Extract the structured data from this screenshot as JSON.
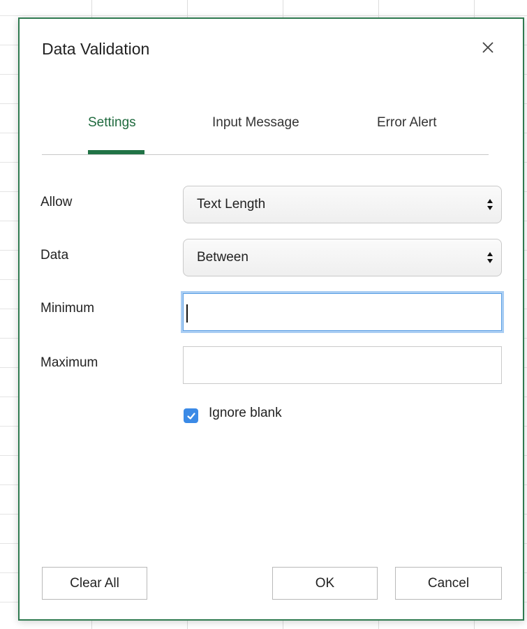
{
  "dialog": {
    "title": "Data Validation",
    "close_icon": "close-icon",
    "accent_color": "#217346"
  },
  "tabs": [
    {
      "label": "Settings",
      "active": true
    },
    {
      "label": "Input Message",
      "active": false
    },
    {
      "label": "Error Alert",
      "active": false
    }
  ],
  "form": {
    "allow": {
      "label": "Allow",
      "value": "Text Length"
    },
    "data": {
      "label": "Data",
      "value": "Between"
    },
    "minimum": {
      "label": "Minimum",
      "value": "",
      "focused": true
    },
    "maximum": {
      "label": "Maximum",
      "value": ""
    },
    "ignore_blank": {
      "label": "Ignore blank",
      "checked": true
    }
  },
  "buttons": {
    "clear_all": "Clear All",
    "ok": "OK",
    "cancel": "Cancel"
  }
}
